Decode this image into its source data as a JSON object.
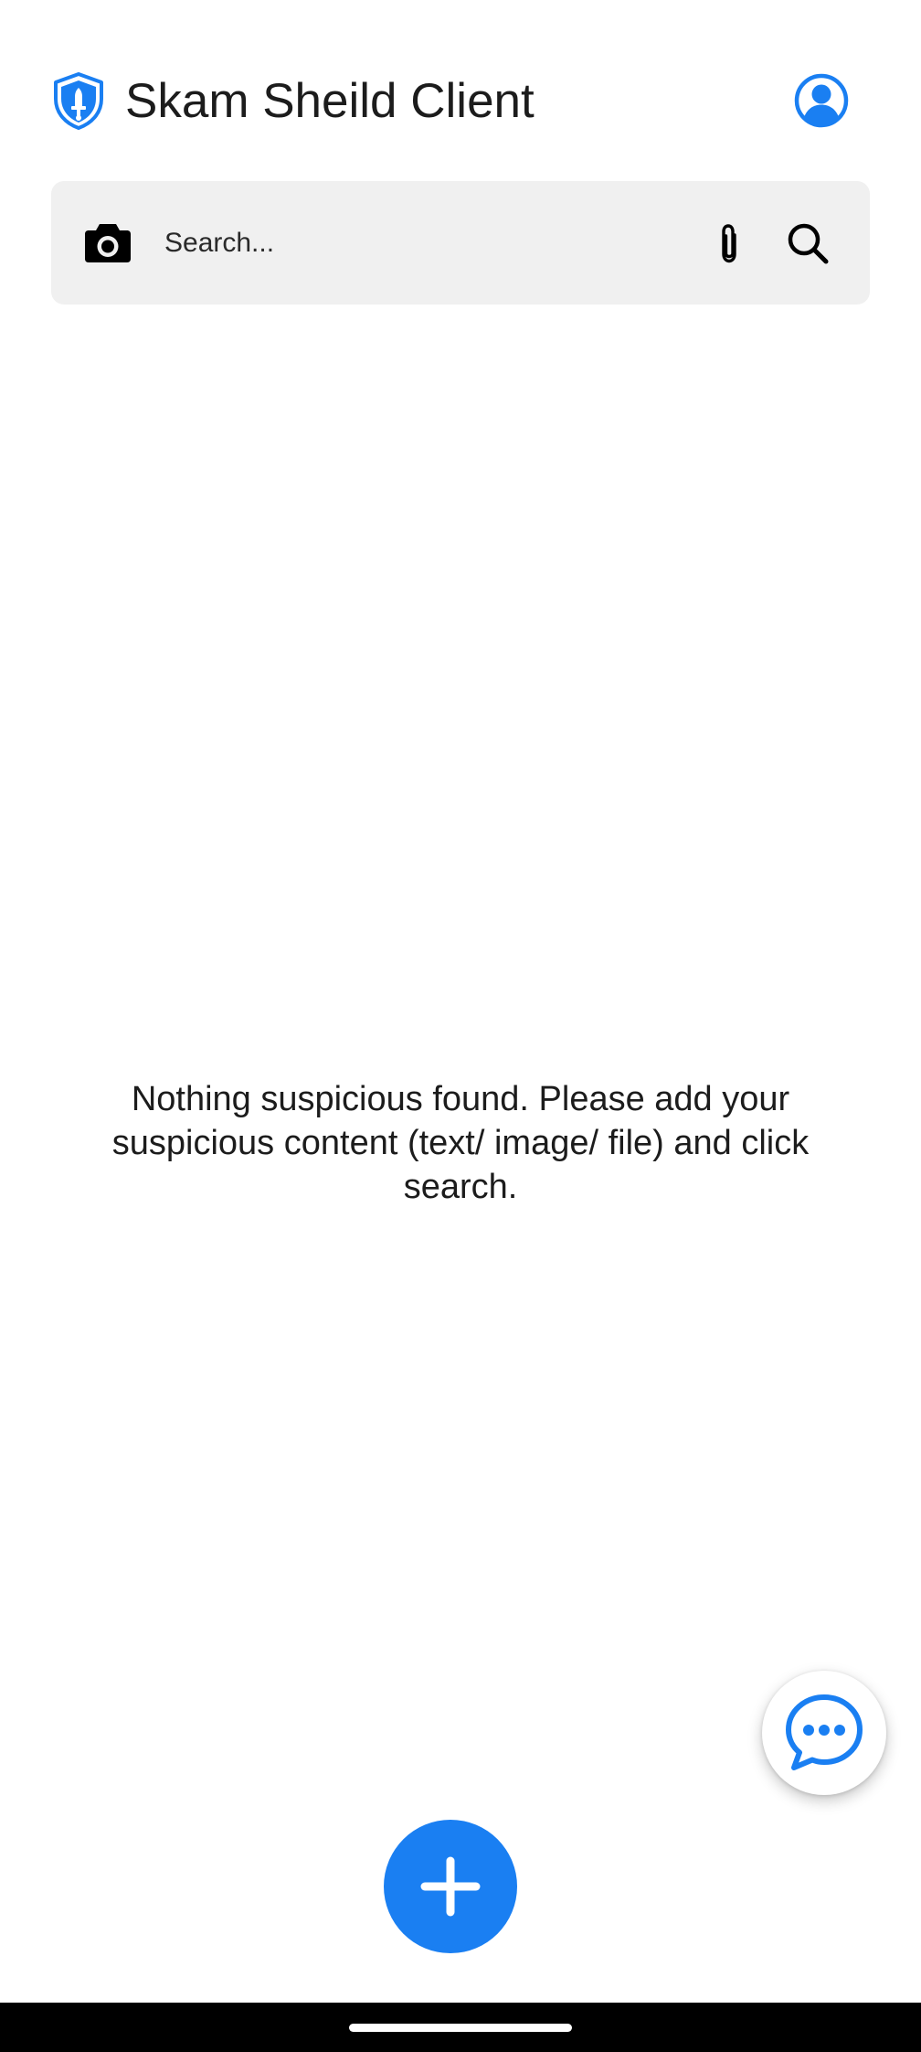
{
  "app": {
    "title": "Skam Sheild Client",
    "logo_icon": "shield-sword-icon",
    "profile_icon": "account-circle-icon",
    "accent_color": "#1a7ff2"
  },
  "search": {
    "value": "",
    "placeholder": "Search...",
    "camera_icon": "camera-icon",
    "attach_icon": "paperclip-icon",
    "search_icon": "search-icon",
    "background_color": "#f0f0f0"
  },
  "main": {
    "empty_message": "Nothing suspicious found. Please add your suspicious content (text/ image/ file) and click search."
  },
  "fabs": {
    "chat_icon": "chat-bubble-icon",
    "add_icon": "plus-icon"
  },
  "system_nav": {
    "background_color": "#000000"
  }
}
